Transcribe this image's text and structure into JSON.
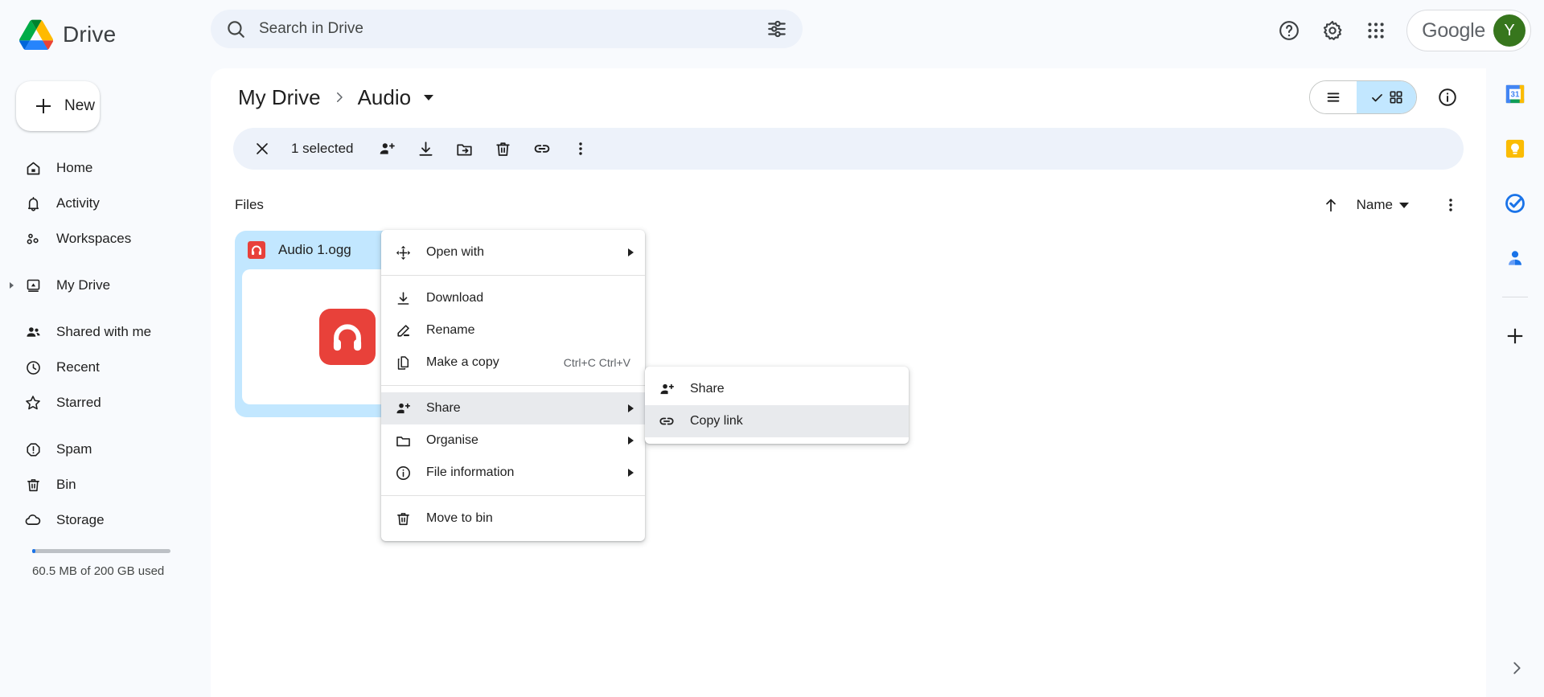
{
  "app": {
    "name": "Drive",
    "logo_colors": {
      "blue": "#1a73e8",
      "green": "#1e8e3e",
      "yellow": "#fbbc04",
      "red": "#ea4335"
    }
  },
  "search": {
    "placeholder": "Search in Drive",
    "value": "",
    "icon": "search-icon",
    "filter_icon": "tune-icon"
  },
  "header_actions": {
    "help_label": "Support",
    "settings_label": "Settings",
    "apps_label": "Google apps",
    "account_brand": "Google",
    "avatar_initial": "Y",
    "avatar_color": "#37761d"
  },
  "sidebar": {
    "new_button": "New",
    "groups": [
      {
        "items": [
          {
            "label": "Home",
            "icon": "home-icon",
            "expandable": false
          },
          {
            "label": "Activity",
            "icon": "bell-icon",
            "expandable": false
          },
          {
            "label": "Workspaces",
            "icon": "workspaces-icon",
            "expandable": false
          }
        ]
      },
      {
        "items": [
          {
            "label": "My Drive",
            "icon": "drive-folder-icon",
            "expandable": true
          }
        ]
      },
      {
        "items": [
          {
            "label": "Shared with me",
            "icon": "people-icon",
            "expandable": false
          },
          {
            "label": "Recent",
            "icon": "clock-icon",
            "expandable": false
          },
          {
            "label": "Starred",
            "icon": "star-icon",
            "expandable": false
          }
        ]
      },
      {
        "items": [
          {
            "label": "Spam",
            "icon": "spam-icon",
            "expandable": false
          },
          {
            "label": "Bin",
            "icon": "trash-icon",
            "expandable": false
          },
          {
            "label": "Storage",
            "icon": "cloud-icon",
            "expandable": false
          }
        ]
      }
    ],
    "storage": {
      "text": "60.5 MB of 200 GB used",
      "used_percent": 2,
      "bar_color": "#1a73e8"
    }
  },
  "breadcrumb": {
    "root": "My Drive",
    "separator": "›",
    "current": "Audio"
  },
  "view_toggle": {
    "list_label": "List layout",
    "grid_label": "Grid layout",
    "active": "grid",
    "active_color": "#c2e7ff"
  },
  "details_button": "View details",
  "selection_toolbar": {
    "close_label": "Clear selection",
    "count_text": "1 selected",
    "actions": [
      {
        "name": "share-button",
        "icon": "person-add-icon"
      },
      {
        "name": "download-button",
        "icon": "download-icon"
      },
      {
        "name": "move-button",
        "icon": "folder-move-icon"
      },
      {
        "name": "delete-button",
        "icon": "trash-icon"
      },
      {
        "name": "copy-link-button",
        "icon": "link-icon"
      },
      {
        "name": "more-actions-button",
        "icon": "more-vertical-icon"
      }
    ]
  },
  "files_section": {
    "title": "Files",
    "sort_direction_label": "Sort direction",
    "sort_by": "Name",
    "more_label": "More sort options",
    "items": [
      {
        "name": "Audio 1.ogg",
        "type": "audio",
        "selected": true,
        "icon_color": "#e8413a"
      }
    ]
  },
  "context_menu": {
    "items": [
      {
        "label": "Open with",
        "icon": "open-with-icon",
        "submenu": true,
        "shortcut": "",
        "highlighted": false
      },
      {
        "separator": true
      },
      {
        "label": "Download",
        "icon": "download-icon",
        "submenu": false,
        "shortcut": "",
        "highlighted": false
      },
      {
        "label": "Rename",
        "icon": "pencil-icon",
        "submenu": false,
        "shortcut": "",
        "highlighted": false
      },
      {
        "label": "Make a copy",
        "icon": "copy-icon",
        "submenu": false,
        "shortcut": "Ctrl+C Ctrl+V",
        "highlighted": false
      },
      {
        "separator": true
      },
      {
        "label": "Share",
        "icon": "person-add-icon",
        "submenu": true,
        "shortcut": "",
        "highlighted": true
      },
      {
        "label": "Organise",
        "icon": "folder-icon",
        "submenu": true,
        "shortcut": "",
        "highlighted": false
      },
      {
        "label": "File information",
        "icon": "info-icon",
        "submenu": true,
        "shortcut": "",
        "highlighted": false
      },
      {
        "separator": true
      },
      {
        "label": "Move to bin",
        "icon": "trash-icon",
        "submenu": false,
        "shortcut": "",
        "highlighted": false
      }
    ]
  },
  "context_submenu": {
    "items": [
      {
        "label": "Share",
        "icon": "person-add-icon",
        "highlighted": false
      },
      {
        "label": "Copy link",
        "icon": "link-icon",
        "highlighted": true
      }
    ]
  },
  "right_rail": {
    "apps": [
      {
        "name": "calendar",
        "label": "Calendar",
        "badge": "31"
      },
      {
        "name": "keep",
        "label": "Keep"
      },
      {
        "name": "tasks",
        "label": "Tasks"
      },
      {
        "name": "contacts",
        "label": "Contacts"
      }
    ],
    "add_label": "Get add-ons",
    "expand_label": "Show side panel"
  }
}
